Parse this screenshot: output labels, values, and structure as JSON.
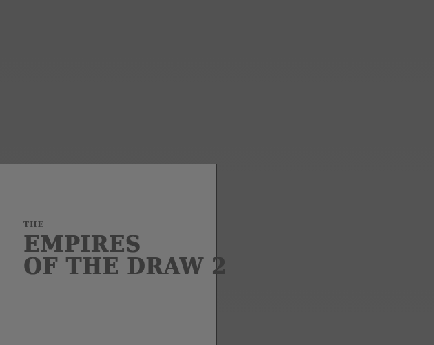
{
  "game": {
    "title": {
      "article": "THE",
      "line1": "EMPIRES",
      "line2": "OF THE DRAW 2"
    }
  },
  "colors": {
    "background": "#535353",
    "panel": "#777777",
    "panel_border": "#2f2f2f",
    "title_text": "#3a3a3a"
  }
}
